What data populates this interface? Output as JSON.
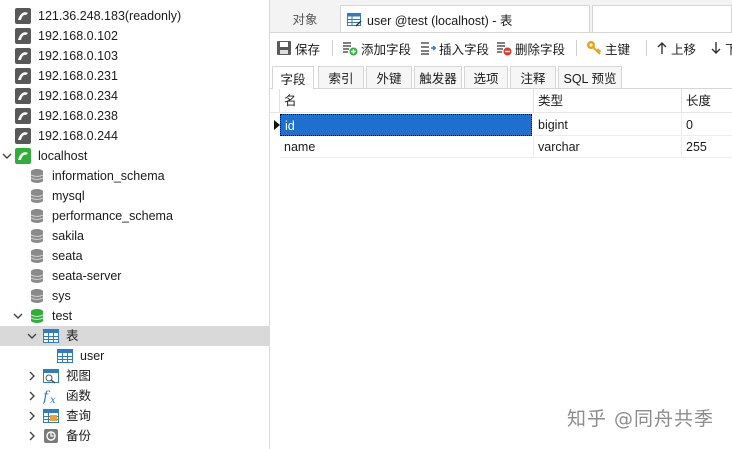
{
  "navigator": {
    "connections": [
      {
        "label": "121.36.248.183(readonly)"
      },
      {
        "label": "192.168.0.102"
      },
      {
        "label": "192.168.0.103"
      },
      {
        "label": "192.168.0.231"
      },
      {
        "label": "192.168.0.234"
      },
      {
        "label": "192.168.0.238"
      },
      {
        "label": "192.168.0.244"
      }
    ],
    "localhost": {
      "label": "localhost"
    },
    "databases": [
      {
        "label": "information_schema"
      },
      {
        "label": "mysql"
      },
      {
        "label": "performance_schema"
      },
      {
        "label": "sakila"
      },
      {
        "label": "seata"
      },
      {
        "label": "seata-server"
      },
      {
        "label": "sys"
      }
    ],
    "test_db": {
      "label": "test"
    },
    "test_children": {
      "tables": {
        "label": "表"
      },
      "user_table": {
        "label": "user"
      },
      "views": {
        "label": "视图"
      },
      "functions": {
        "label": "函数"
      },
      "queries": {
        "label": "查询"
      },
      "backups": {
        "label": "备份"
      }
    }
  },
  "tabs": {
    "objects": "对象",
    "active": "user @test (localhost) - 表"
  },
  "toolbar": {
    "save": "保存",
    "add_field": "添加字段",
    "insert_field": "插入字段",
    "delete_field": "删除字段",
    "primary_key": "主键",
    "move_up": "上移",
    "move_down": "下"
  },
  "subtabs": [
    "字段",
    "索引",
    "外键",
    "触发器",
    "选项",
    "注释",
    "SQL 预览"
  ],
  "grid": {
    "headers": {
      "name": "名",
      "type": "类型",
      "length": "长度"
    },
    "rows": [
      {
        "name": "id",
        "type": "bigint",
        "length": "0"
      },
      {
        "name": "name",
        "type": "varchar",
        "length": "255"
      }
    ]
  },
  "watermark": "知乎 @同舟共季",
  "colors": {
    "selection": "#1f6fcf",
    "db_green": "#2fae3a",
    "tree_selected": "#d9d9d9"
  }
}
